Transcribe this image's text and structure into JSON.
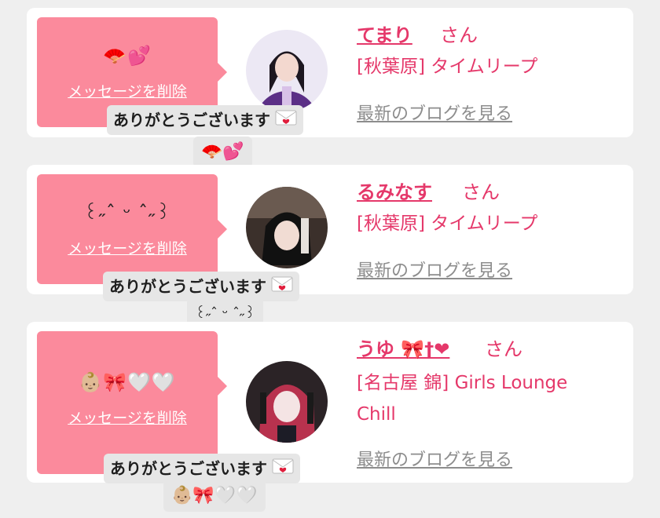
{
  "entries": [
    {
      "bubble_emoji": "🪭💕",
      "delete_label": "メッセージを削除",
      "name": "てまり",
      "suffix": "さん",
      "shop": "[秋葉原] タイムリープ",
      "blog_link": "最新のブログを見る",
      "reply_text": "ありがとうございます",
      "reply_emoji": "🪭💕",
      "avatar_colors": [
        "#e9e6f5",
        "#5a2d7a"
      ]
    },
    {
      "bubble_emoji": "꒰˶ˆ ᵕ ˆ˶꒱",
      "delete_label": "メッセージを削除",
      "name": "るみなす",
      "suffix": "さん",
      "shop": "[秋葉原] タイムリープ",
      "blog_link": "最新のブログを見る",
      "reply_text": "ありがとうございます",
      "reply_emoji": "꒰˶ˆ ᵕ ˆ˶꒱",
      "avatar_colors": [
        "#3a2e2a",
        "#d8cfc8"
      ]
    },
    {
      "bubble_emoji": "👶🏼🎀🤍🤍",
      "delete_label": "メッセージを削除",
      "name": "うゆ 🎀†❤",
      "suffix": "さん",
      "shop": "[名古屋 錦] Girls Lounge Chill",
      "blog_link": "最新のブログを見る",
      "reply_text": "ありがとうございます",
      "reply_emoji": "👶🏼🎀🤍🤍",
      "avatar_colors": [
        "#2a1f22",
        "#c63a55"
      ]
    }
  ],
  "colors": {
    "bubble": "#fb8a9c",
    "accent": "#e5386a",
    "link_gray": "#8d8d8d",
    "background": "#efefef"
  }
}
